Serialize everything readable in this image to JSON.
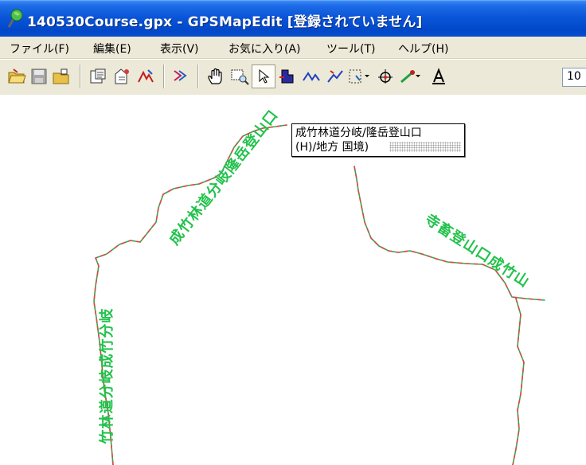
{
  "window": {
    "title": "140530Course.gpx - GPSMapEdit [登録されていません]",
    "title_icon": "app-globe-icon"
  },
  "menu": {
    "items": [
      {
        "label": "ファイル(F)"
      },
      {
        "label": "編集(E)"
      },
      {
        "label": "表示(V)"
      },
      {
        "label": "お気に入り(A)"
      },
      {
        "label": "ツール(T)"
      },
      {
        "label": "ヘルプ(H)"
      }
    ]
  },
  "toolbar": {
    "icons": [
      "open-folder-icon",
      "save-icon",
      "open-file-icon",
      "properties-icon",
      "map-properties-icon",
      "transform-icon",
      "track-icon",
      "hand-pan-icon",
      "zoom-rect-icon",
      "select-arrow-icon",
      "polygon-fill-icon",
      "polyline-icon",
      "polyline-edit-icon",
      "rect-select-icon",
      "point-add-icon",
      "measure-icon",
      "label-icon"
    ],
    "zoom_value": "10"
  },
  "map": {
    "tooltip": {
      "line1": "成竹林道分岐/隆岳登山口",
      "line2": "(H)/地方 国境)"
    },
    "labels": {
      "left_vertical": "竹林道分岐成竹分岐",
      "top_diagonal": "成竹林道分岐隆岳登山口",
      "right_diagonal": "寺畜登山口成竹山"
    },
    "track_colors": {
      "green": "#22b24c",
      "red": "#d84a4a"
    },
    "label_color": "#22c24c"
  }
}
